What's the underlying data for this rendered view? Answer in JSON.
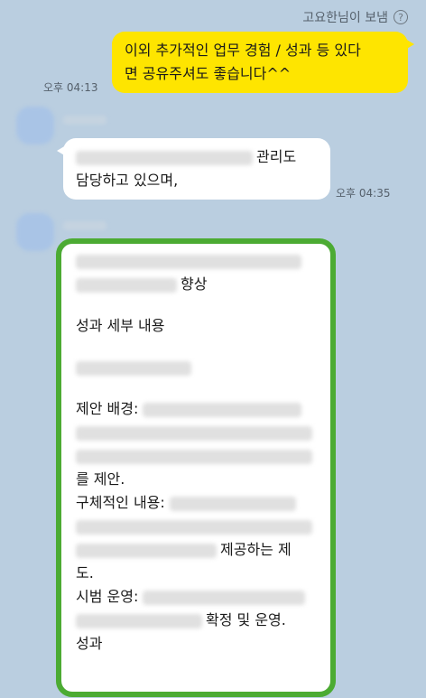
{
  "header": {
    "sender": "고요한님이 보냄"
  },
  "messages": {
    "mine": {
      "line1": "이외 추가적인 업무 경험 / 성과 등 있다",
      "line2": "면 공유주셔도 좋습니다^^",
      "time": "오후 04:13"
    },
    "reply1": {
      "line1_end": "관리도",
      "line2": "담당하고 있으며,",
      "time": "오후 04:35"
    },
    "reply2": {
      "l2_end": "향상",
      "sec_title": "성과 세부 내용",
      "bg_label": "제안 배경:",
      "bg_end": "를 제안.",
      "detail_label": "구체적인 내용:",
      "detail_end": "제공하는 제",
      "detail_end2": "도.",
      "pilot_label": "시범 운영:",
      "pilot_end": "확정 및 운영.",
      "result": "성과"
    }
  }
}
